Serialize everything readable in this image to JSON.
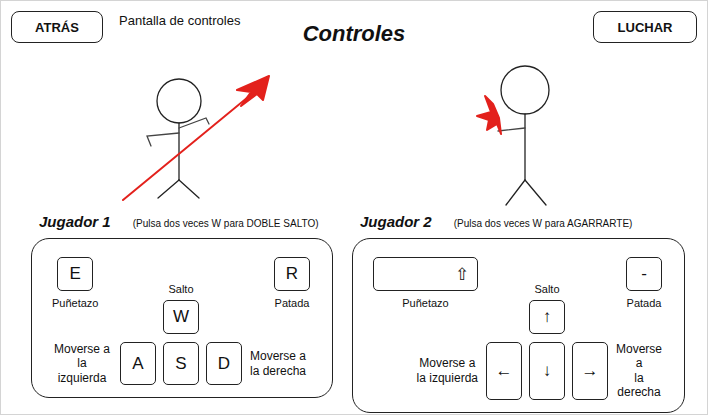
{
  "header": {
    "back_button": "ATRÁS",
    "screen_label": "Pantalla de controles",
    "title": "Controles",
    "fight_button": "LUCHAR"
  },
  "players": [
    {
      "name": "Jugador 1",
      "hint": "(Pulsa dos veces W para DOBLE SALTO)",
      "controls": {
        "punch": {
          "key": "E",
          "kind": "normal",
          "label": "Puñetazo"
        },
        "jump": {
          "key": "W",
          "label": "Salto"
        },
        "kick": {
          "key": "R",
          "label": "Patada"
        },
        "move_left": {
          "key": "A",
          "label_lines": [
            "Moverse a",
            "la izquierda"
          ]
        },
        "down": {
          "key": "S"
        },
        "move_right": {
          "key": "D",
          "label_lines": [
            "Moverse a",
            "la derecha"
          ]
        }
      }
    },
    {
      "name": "Jugador 2",
      "hint": "(Pulsa dos veces W para AGARRARTE)",
      "controls": {
        "punch": {
          "key": "⇧",
          "kind": "wide",
          "label": "Puñetazo"
        },
        "jump": {
          "key": "↑",
          "label": "Salto"
        },
        "kick": {
          "key": "-",
          "label": "Patada"
        },
        "move_left": {
          "key": "←",
          "label_lines": [
            "Moverse a",
            "la izquierda"
          ]
        },
        "down": {
          "key": "↓"
        },
        "move_right": {
          "key": "→",
          "label_lines": [
            "Moverse a",
            "la derecha"
          ]
        }
      }
    }
  ]
}
